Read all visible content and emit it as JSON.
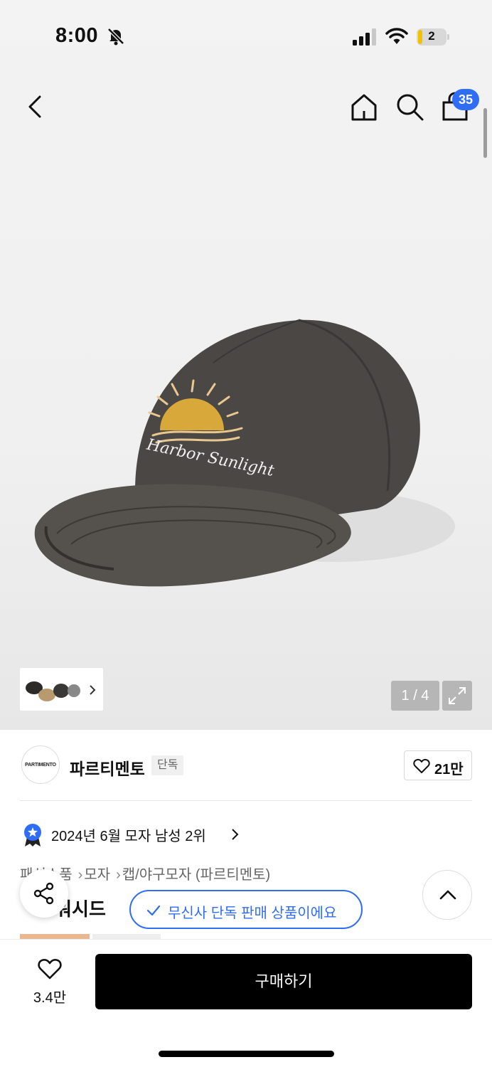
{
  "status_bar": {
    "time": "8:00",
    "battery_level": "2",
    "icons": [
      "bell-slash-icon",
      "cellular-signal-icon",
      "wifi-icon",
      "battery-icon"
    ]
  },
  "top_nav": {
    "icons": [
      "back-icon",
      "home-icon",
      "search-icon",
      "shopping-bag-icon"
    ],
    "cart_count": "35"
  },
  "gallery": {
    "page_indicator": "1 / 4",
    "product_image_text": "Harbor Sunlight",
    "icons": [
      "chevron-right-icon",
      "expand-icon"
    ]
  },
  "brand": {
    "logo_text": "PARTIMENTO",
    "name": "파르티멘토",
    "exclusive_tag": "단독",
    "like_count": "21만"
  },
  "ranking": {
    "text": "2024년 6월 모자 남성 2위",
    "badge_color": "#2f6df6"
  },
  "breadcrumb": [
    "패션소품",
    "모자",
    "캡/야구모자 (파르티멘토)"
  ],
  "product": {
    "title_fragment": "워시드"
  },
  "toast": {
    "text": "무신사 단독 판매 상품이에요",
    "accent": "#2f6df6"
  },
  "bottom_bar": {
    "wish_count": "3.4만",
    "buy_label": "구매하기"
  },
  "colors": {
    "accent_blue": "#2f6df6",
    "buy_button": "#000000",
    "cap_body": "#4a4744",
    "sun_embroidery": "#d9a83a"
  }
}
